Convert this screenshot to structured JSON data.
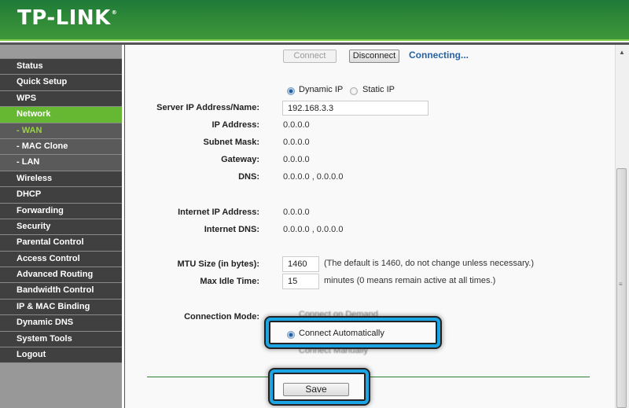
{
  "header": {
    "brand": "TP-LINK",
    "trademark": "®",
    "colors": {
      "header_green": "#2f8a38",
      "active_nav": "#66b731",
      "highlight_blue": "#1aa6e4",
      "status_blue": "#2662a8"
    }
  },
  "sidebar": {
    "items": [
      {
        "label": "Status"
      },
      {
        "label": "Quick Setup"
      },
      {
        "label": "WPS"
      },
      {
        "label": "Network",
        "active": true
      },
      {
        "label": "- WAN",
        "sub": true,
        "active": true
      },
      {
        "label": "- MAC Clone",
        "sub": true
      },
      {
        "label": "- LAN",
        "sub": true
      },
      {
        "label": "Wireless"
      },
      {
        "label": "DHCP"
      },
      {
        "label": "Forwarding"
      },
      {
        "label": "Security"
      },
      {
        "label": "Parental Control"
      },
      {
        "label": "Access Control"
      },
      {
        "label": "Advanced Routing"
      },
      {
        "label": "Bandwidth Control"
      },
      {
        "label": "IP & MAC Binding"
      },
      {
        "label": "Dynamic DNS"
      },
      {
        "label": "System Tools"
      },
      {
        "label": "Logout"
      }
    ]
  },
  "main": {
    "connect_label": "Connect",
    "disconnect_label": "Disconnect",
    "status": "Connecting...",
    "ip_mode": {
      "dynamic_label": "Dynamic IP",
      "static_label": "Static IP",
      "selected": "Dynamic IP"
    },
    "fields": {
      "server_label": "Server IP Address/Name:",
      "server_value": "192.168.3.3",
      "ip_label": "IP Address:",
      "ip_value": "0.0.0.0",
      "mask_label": "Subnet Mask:",
      "mask_value": "0.0.0.0",
      "gateway_label": "Gateway:",
      "gateway_value": "0.0.0.0",
      "dns_label": "DNS:",
      "dns_value": "0.0.0.0 , 0.0.0.0",
      "inet_ip_label": "Internet IP Address:",
      "inet_ip_value": "0.0.0.0",
      "inet_dns_label": "Internet DNS:",
      "inet_dns_value": "0.0.0.0 , 0.0.0.0",
      "mtu_label": "MTU Size (in bytes):",
      "mtu_value": "1460",
      "mtu_note": "(The default is 1460, do not change unless necessary.)",
      "idle_label": "Max Idle Time:",
      "idle_value": "15",
      "idle_note": "minutes (0 means remain active at all times.)"
    },
    "connection_mode": {
      "label": "Connection Mode:",
      "options": [
        "Connect on Demand",
        "Connect Automatically",
        "Connect Manually"
      ],
      "selected": "Connect Automatically"
    },
    "save_label": "Save"
  }
}
